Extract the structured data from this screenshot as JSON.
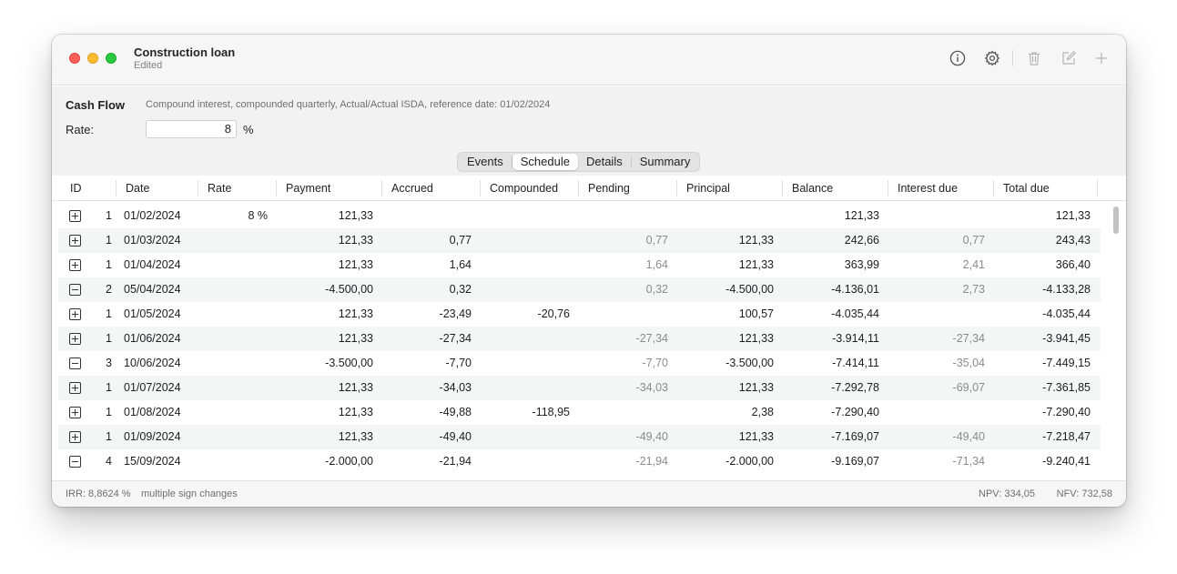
{
  "window": {
    "title": "Construction loan",
    "subtitle": "Edited"
  },
  "toolbar": {
    "icons": [
      "info-icon",
      "gear-icon",
      "trash-icon",
      "compose-icon",
      "plus-icon"
    ]
  },
  "cashflow": {
    "label": "Cash Flow",
    "description": "Compound interest, compounded quarterly, Actual/Actual ISDA, reference date: 01/02/2024",
    "rate_label": "Rate:",
    "rate_value": "8",
    "rate_unit": "%"
  },
  "tabs": {
    "events": "Events",
    "schedule": "Schedule",
    "details": "Details",
    "summary": "Summary",
    "selected": "Schedule"
  },
  "table": {
    "columns": [
      "ID",
      "Date",
      "Rate",
      "Payment",
      "Accrued",
      "Compounded",
      "Pending",
      "Principal",
      "Balance",
      "Interest due",
      "Total due"
    ],
    "rows": [
      {
        "sign": "plus",
        "id": "1",
        "date": "01/02/2024",
        "rate": "8 %",
        "payment": "121,33",
        "accrued": "",
        "compounded": "",
        "pending": "",
        "principal": "",
        "balance": "121,33",
        "interest_due": "",
        "total_due": "121,33"
      },
      {
        "sign": "plus",
        "id": "1",
        "date": "01/03/2024",
        "rate": "",
        "payment": "121,33",
        "accrued": "0,77",
        "compounded": "",
        "pending": "0,77",
        "principal": "121,33",
        "balance": "242,66",
        "interest_due": "0,77",
        "total_due": "243,43"
      },
      {
        "sign": "plus",
        "id": "1",
        "date": "01/04/2024",
        "rate": "",
        "payment": "121,33",
        "accrued": "1,64",
        "compounded": "",
        "pending": "1,64",
        "principal": "121,33",
        "balance": "363,99",
        "interest_due": "2,41",
        "total_due": "366,40"
      },
      {
        "sign": "minus",
        "id": "2",
        "date": "05/04/2024",
        "rate": "",
        "payment": "-4.500,00",
        "accrued": "0,32",
        "compounded": "",
        "pending": "0,32",
        "principal": "-4.500,00",
        "balance": "-4.136,01",
        "interest_due": "2,73",
        "total_due": "-4.133,28"
      },
      {
        "sign": "plus",
        "id": "1",
        "date": "01/05/2024",
        "rate": "",
        "payment": "121,33",
        "accrued": "-23,49",
        "compounded": "-20,76",
        "pending": "",
        "principal": "100,57",
        "balance": "-4.035,44",
        "interest_due": "",
        "total_due": "-4.035,44"
      },
      {
        "sign": "plus",
        "id": "1",
        "date": "01/06/2024",
        "rate": "",
        "payment": "121,33",
        "accrued": "-27,34",
        "compounded": "",
        "pending": "-27,34",
        "principal": "121,33",
        "balance": "-3.914,11",
        "interest_due": "-27,34",
        "total_due": "-3.941,45"
      },
      {
        "sign": "minus",
        "id": "3",
        "date": "10/06/2024",
        "rate": "",
        "payment": "-3.500,00",
        "accrued": "-7,70",
        "compounded": "",
        "pending": "-7,70",
        "principal": "-3.500,00",
        "balance": "-7.414,11",
        "interest_due": "-35,04",
        "total_due": "-7.449,15"
      },
      {
        "sign": "plus",
        "id": "1",
        "date": "01/07/2024",
        "rate": "",
        "payment": "121,33",
        "accrued": "-34,03",
        "compounded": "",
        "pending": "-34,03",
        "principal": "121,33",
        "balance": "-7.292,78",
        "interest_due": "-69,07",
        "total_due": "-7.361,85"
      },
      {
        "sign": "plus",
        "id": "1",
        "date": "01/08/2024",
        "rate": "",
        "payment": "121,33",
        "accrued": "-49,88",
        "compounded": "-118,95",
        "pending": "",
        "principal": "2,38",
        "balance": "-7.290,40",
        "interest_due": "",
        "total_due": "-7.290,40"
      },
      {
        "sign": "plus",
        "id": "1",
        "date": "01/09/2024",
        "rate": "",
        "payment": "121,33",
        "accrued": "-49,40",
        "compounded": "",
        "pending": "-49,40",
        "principal": "121,33",
        "balance": "-7.169,07",
        "interest_due": "-49,40",
        "total_due": "-7.218,47"
      },
      {
        "sign": "minus",
        "id": "4",
        "date": "15/09/2024",
        "rate": "",
        "payment": "-2.000,00",
        "accrued": "-21,94",
        "compounded": "",
        "pending": "-21,94",
        "principal": "-2.000,00",
        "balance": "-9.169,07",
        "interest_due": "-71,34",
        "total_due": "-9.240,41"
      }
    ]
  },
  "status": {
    "irr": "IRR: 8,8624 %",
    "note": "multiple sign changes",
    "npv": "NPV:  334,05",
    "nfv": "NFV:  732,58"
  }
}
